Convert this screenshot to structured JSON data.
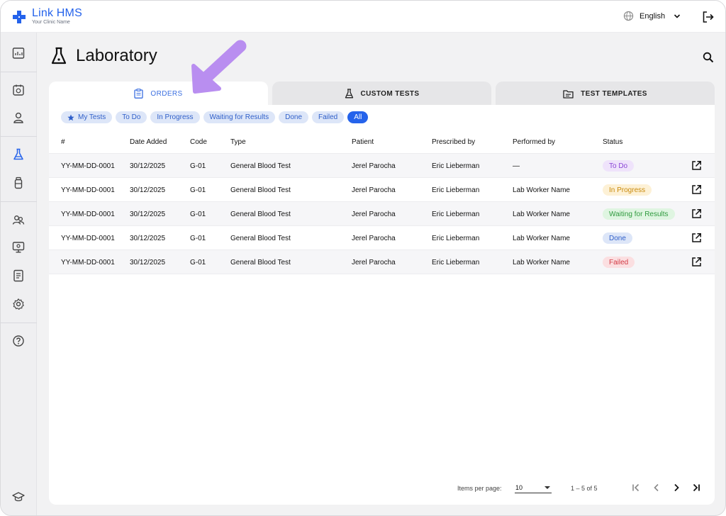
{
  "app": {
    "name": "Link HMS",
    "subtitle": "Your Clinic Name",
    "language": "English",
    "brand_color": "#2563eb"
  },
  "sidebar": {
    "items": [
      {
        "icon": "dashboard-icon"
      },
      {
        "icon": "calendar-icon"
      },
      {
        "icon": "patient-icon"
      },
      {
        "icon": "flask-icon",
        "active": true
      },
      {
        "icon": "bottle-icon"
      },
      {
        "icon": "users-icon"
      },
      {
        "icon": "monitor-icon"
      },
      {
        "icon": "report-icon"
      },
      {
        "icon": "settings-icon"
      },
      {
        "icon": "help-icon"
      },
      {
        "icon": "graduation-cap-icon"
      }
    ]
  },
  "page": {
    "title": "Laboratory"
  },
  "tabs": [
    {
      "label": "ORDERS",
      "icon": "clipboard-icon",
      "active": true
    },
    {
      "label": "CUSTOM TESTS",
      "icon": "flask-icon",
      "active": false
    },
    {
      "label": "TEST TEMPLATES",
      "icon": "folder-icon",
      "active": false
    }
  ],
  "filters": [
    {
      "label": "My Tests",
      "icon": "star-icon"
    },
    {
      "label": "To Do"
    },
    {
      "label": "In Progress"
    },
    {
      "label": "Waiting for Results"
    },
    {
      "label": "Done"
    },
    {
      "label": "Failed"
    },
    {
      "label": "All",
      "selected": true
    }
  ],
  "table": {
    "columns": [
      "#",
      "Date Added",
      "Code",
      "Type",
      "Patient",
      "Prescribed by",
      "Performed by",
      "Status"
    ],
    "rows": [
      {
        "id": "YY-MM-DD-0001",
        "date": "30/12/2025",
        "code": "G-01",
        "type": "General Blood Test",
        "patient": "Jerel Parocha",
        "prescribed_by": "Eric Lieberman",
        "performed_by": "—",
        "status": "To Do"
      },
      {
        "id": "YY-MM-DD-0001",
        "date": "30/12/2025",
        "code": "G-01",
        "type": "General Blood Test",
        "patient": "Jerel Parocha",
        "prescribed_by": "Eric Lieberman",
        "performed_by": "Lab Worker Name",
        "status": "In Progress"
      },
      {
        "id": "YY-MM-DD-0001",
        "date": "30/12/2025",
        "code": "G-01",
        "type": "General Blood Test",
        "patient": "Jerel Parocha",
        "prescribed_by": "Eric Lieberman",
        "performed_by": "Lab Worker Name",
        "status": "Waiting for Results"
      },
      {
        "id": "YY-MM-DD-0001",
        "date": "30/12/2025",
        "code": "G-01",
        "type": "General Blood Test",
        "patient": "Jerel Parocha",
        "prescribed_by": "Eric Lieberman",
        "performed_by": "Lab Worker Name",
        "status": "Done"
      },
      {
        "id": "YY-MM-DD-0001",
        "date": "30/12/2025",
        "code": "G-01",
        "type": "General Blood Test",
        "patient": "Jerel Parocha",
        "prescribed_by": "Eric Lieberman",
        "performed_by": "Lab Worker Name",
        "status": "Failed"
      }
    ]
  },
  "status_colors": {
    "To Do": {
      "bg": "#efe3fb",
      "fg": "#8b46d6"
    },
    "In Progress": {
      "bg": "#fdf1d6",
      "fg": "#c98a0c"
    },
    "Waiting for Results": {
      "bg": "#dff5e1",
      "fg": "#2f9a3e"
    },
    "Done": {
      "bg": "#dde6f8",
      "fg": "#2f5fc9"
    },
    "Failed": {
      "bg": "#fbdfe1",
      "fg": "#d23a44"
    }
  },
  "pagination": {
    "items_per_page_label": "Items per page:",
    "items_per_page": "10",
    "range": "1 – 5 of 5"
  },
  "annotation": {
    "color": "#b98ef0"
  }
}
